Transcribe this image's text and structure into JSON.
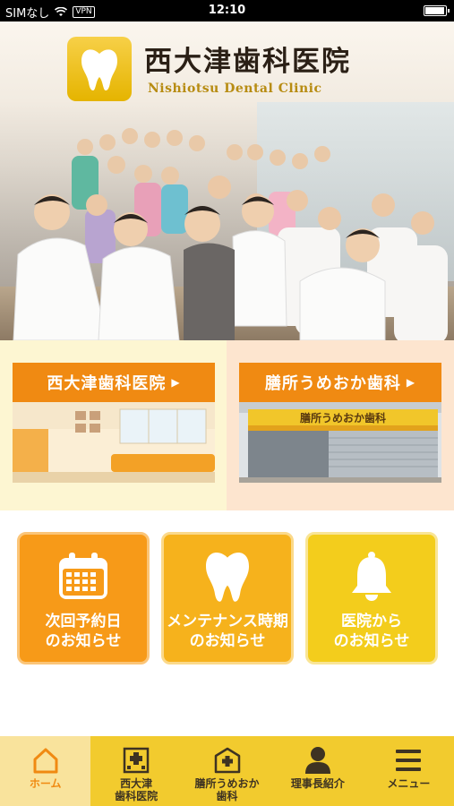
{
  "status_bar": {
    "carrier": "SIMなし",
    "vpn": "VPN",
    "time": "12:10"
  },
  "header": {
    "clinic_name": "西大津歯科医院",
    "clinic_name_en": "Nishiotsu Dental Clinic"
  },
  "clinics": [
    {
      "name": "西大津歯科医院",
      "sign": ""
    },
    {
      "name": "膳所うめおか歯科",
      "sign": "膳所うめおか歯科"
    }
  ],
  "notices": [
    {
      "label": "次回予約日\nのお知らせ",
      "icon": "calendar-icon"
    },
    {
      "label": "メンテナンス時期\nのお知らせ",
      "icon": "tooth-icon"
    },
    {
      "label": "医院から\nのお知らせ",
      "icon": "bell-icon"
    }
  ],
  "tabbar": {
    "items": [
      {
        "label": "ホーム",
        "icon": "home-icon",
        "active": true
      },
      {
        "label": "西大津\n歯科医院",
        "icon": "hospital-icon",
        "active": false
      },
      {
        "label": "膳所うめおか\n歯科",
        "icon": "hospital-icon",
        "active": false
      },
      {
        "label": "理事長紹介",
        "icon": "person-icon",
        "active": false
      },
      {
        "label": "メニュー",
        "icon": "menu-icon",
        "active": false
      }
    ]
  },
  "colors": {
    "accent_orange": "#f08a12",
    "tab_yellow": "#f2cb2e",
    "logo_gold": "#e5b400"
  }
}
